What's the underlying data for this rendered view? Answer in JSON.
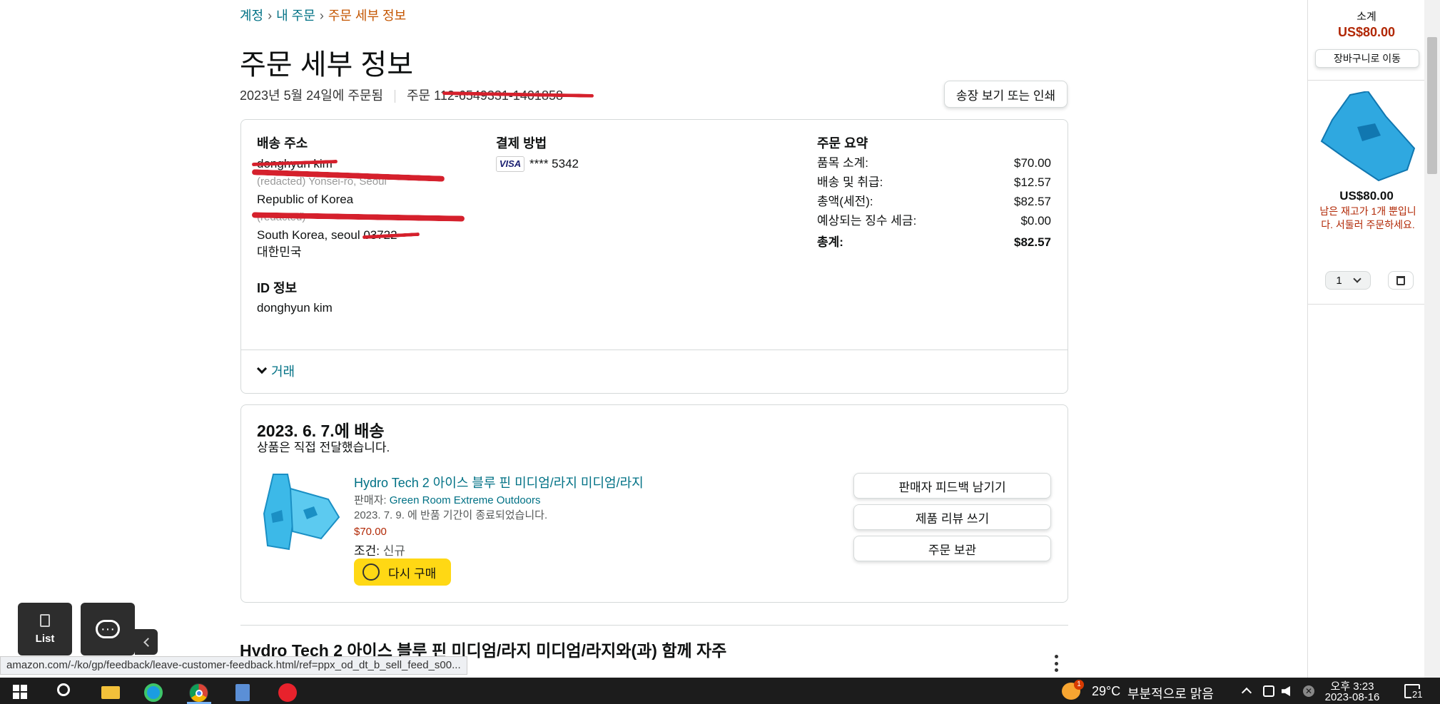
{
  "breadcrumb": {
    "account": "계정",
    "orders": "내 주문",
    "current": "주문 세부 정보",
    "sep": "›"
  },
  "page_title": "주문 세부 정보",
  "order": {
    "date_text": "2023년 5월 24일에 주문됨",
    "number_label": "주문",
    "number_value": "112-6549331-1401858",
    "invoice_button": "송장 보기 또는 인쇄"
  },
  "shipping": {
    "heading": "배송 주소",
    "name": "donghyun kim",
    "line1": "(redacted) Yonsei-ro, Seoul",
    "country": "Republic of Korea",
    "line3": "(redacted)",
    "city": "South Korea, seoul 03722",
    "country_ko": "대한민국"
  },
  "payment": {
    "heading": "결제 방법",
    "card_brand": "VISA",
    "card_number": "**** 5342"
  },
  "summary": {
    "heading": "주문 요약",
    "rows": [
      {
        "label": "품목 소계:",
        "value": "$70.00"
      },
      {
        "label": "배송 및 취급:",
        "value": "$12.57"
      },
      {
        "label": "총액(세전):",
        "value": "$82.57"
      },
      {
        "label": "예상되는 징수 세금:",
        "value": "$0.00"
      }
    ],
    "total_label": "총계:",
    "total_value": "$82.57"
  },
  "identity": {
    "heading": "ID 정보",
    "name": "donghyun kim"
  },
  "transactions_label": "거래",
  "delivery": {
    "heading": "2023. 6. 7.에 배송",
    "sub": "상품은 직접 전달했습니다.",
    "product_title": "Hydro Tech 2 아이스 블루 핀 미디엄/라지 미디엄/라지",
    "seller_label": "판매자: ",
    "seller": "Green Room Extreme Outdoors",
    "return_note": "2023. 7. 9. 에 반품 기간이 종료되었습니다.",
    "price": "$70.00",
    "condition_label": "조건: ",
    "condition": "신규",
    "buy_again": "다시 구매",
    "actions": [
      "판매자 피드백 남기기",
      "제품 리뷰 쓰기",
      "주문 보관"
    ]
  },
  "related_heading": "Hydro Tech 2 아이스 블루 핀 미디엄/라지 미디엄/라지와(과) 함께 자주",
  "sidebar": {
    "subtotal_label": "소계",
    "subtotal_value": "US$80.00",
    "cart_button": "장바구니로 이동",
    "item_price": "US$80.00",
    "stock_note": "남은 재고가 1개 뿐입니다. 서둘러 주문하세요.",
    "qty": "1"
  },
  "floating": {
    "list_label": "List"
  },
  "status_url": "amazon.com/-/ko/gp/feedback/leave-customer-feedback.html/ref=ppx_od_dt_b_sell_feed_s00...",
  "taskbar": {
    "weather_temp": "29°C",
    "weather_text": "부분적으로 맑음",
    "time": "오후 3:23",
    "date": "2023-08-16",
    "notification_count": "21",
    "weather_badge": "1"
  },
  "colors": {
    "link": "#007185",
    "price_red": "#b12704",
    "accent_orange": "#c45500",
    "buy_again_yellow": "#ffd814",
    "redact": "#d5202c"
  }
}
